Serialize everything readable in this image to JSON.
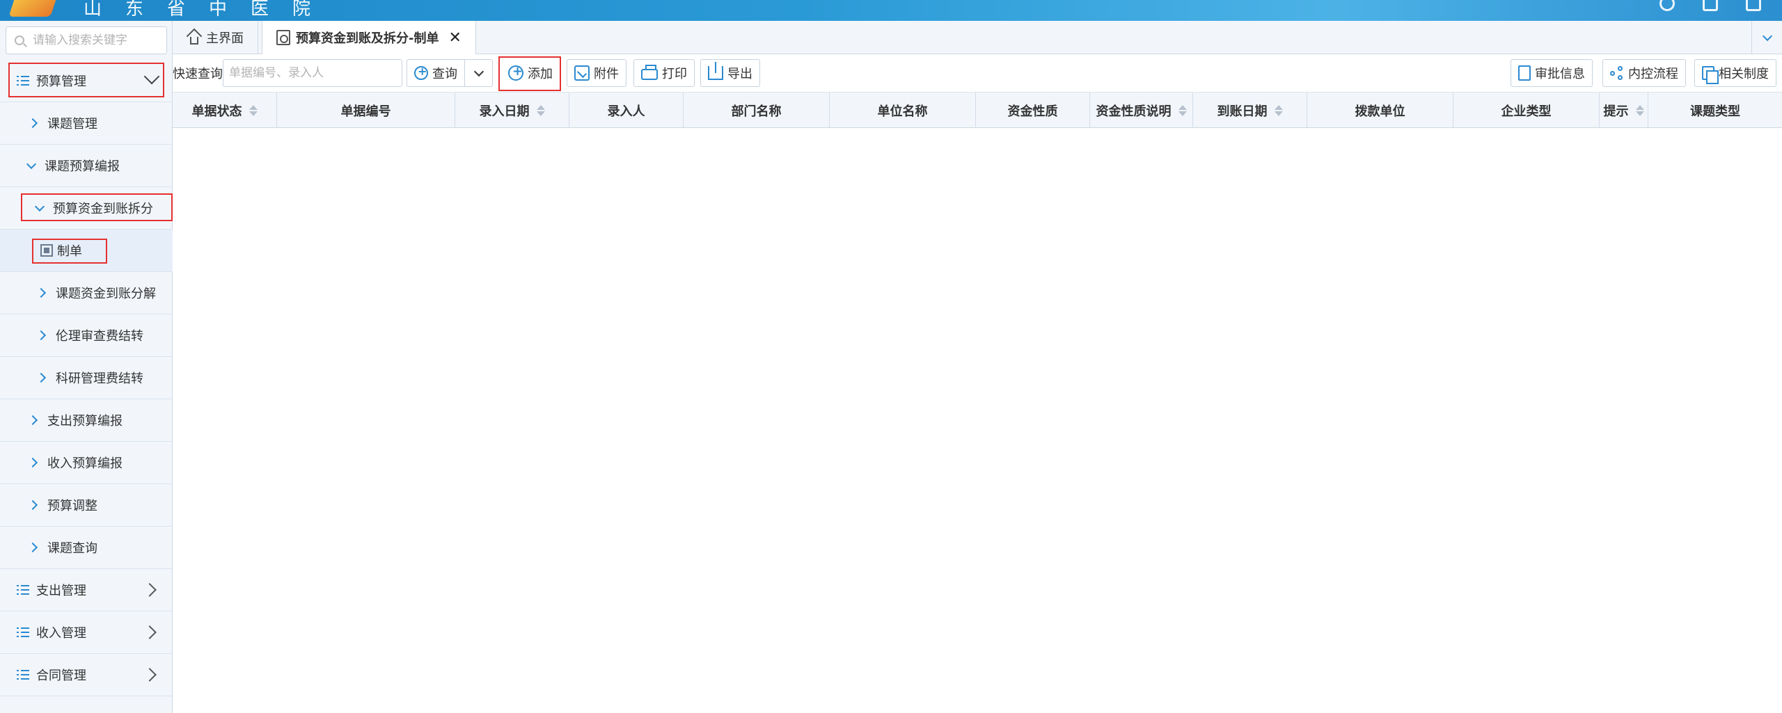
{
  "sidebar": {
    "search_placeholder": "请输入搜索关键字",
    "items": [
      {
        "label": "预算管理"
      },
      {
        "label": "课题管理"
      },
      {
        "label": "课题预算编报"
      },
      {
        "label": "预算资金到账拆分"
      },
      {
        "label": "制单"
      },
      {
        "label": "课题资金到账分解"
      },
      {
        "label": "伦理审查费结转"
      },
      {
        "label": "科研管理费结转"
      },
      {
        "label": "支出预算编报"
      },
      {
        "label": "收入预算编报"
      },
      {
        "label": "预算调整"
      },
      {
        "label": "课题查询"
      },
      {
        "label": "支出管理"
      },
      {
        "label": "收入管理"
      },
      {
        "label": "合同管理"
      }
    ]
  },
  "tabs": [
    {
      "label": "主界面"
    },
    {
      "label": "预算资金到账及拆分-制单"
    }
  ],
  "toolbar": {
    "quick_query_label": "快速查询",
    "quick_query_placeholder": "单据编号、录入人",
    "query": "查询",
    "add": "添加",
    "attach": "附件",
    "print": "打印",
    "export": "导出",
    "approval_info": "审批信息",
    "internal_flow": "内控流程",
    "related_rules": "相关制度"
  },
  "table": {
    "columns": [
      {
        "label": "单据状态"
      },
      {
        "label": "单据编号"
      },
      {
        "label": "录入日期"
      },
      {
        "label": "录入人"
      },
      {
        "label": "部门名称"
      },
      {
        "label": "单位名称"
      },
      {
        "label": "资金性质"
      },
      {
        "label": "资金性质说明"
      },
      {
        "label": "到账日期"
      },
      {
        "label": "拨款单位"
      },
      {
        "label": "企业类型"
      },
      {
        "label": "提示"
      },
      {
        "label": "课题类型"
      }
    ],
    "rows": []
  },
  "colors": {
    "accent": "#2a8ad0",
    "highlight_border": "#e53030",
    "banner": "#1e86c8"
  }
}
